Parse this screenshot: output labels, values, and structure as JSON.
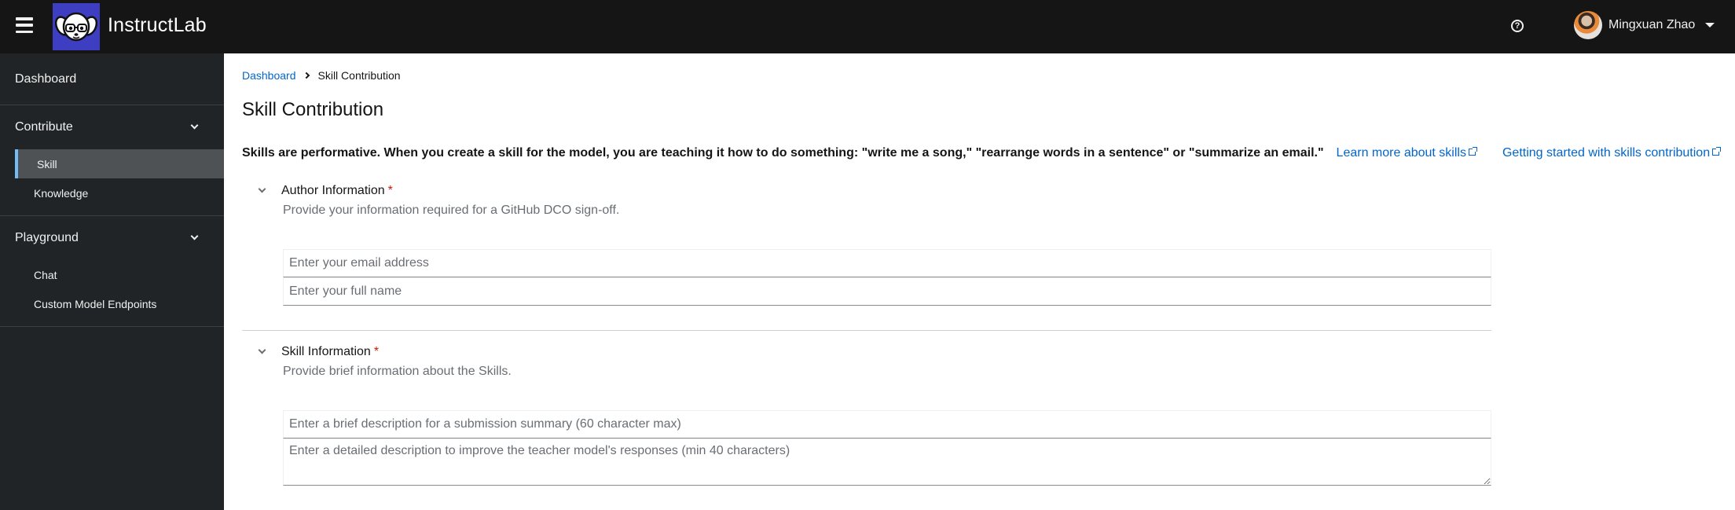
{
  "header": {
    "brand": "InstructLab",
    "user_name": "Mingxuan Zhao",
    "icons": {
      "menu": "hamburger-icon",
      "logo": "dog-with-glasses-logo",
      "help": "question-circle-icon",
      "user_menu": "caret-down-icon"
    },
    "logo_bg_color": "#3d3ec1"
  },
  "sidebar": {
    "items": [
      {
        "label": "Dashboard"
      },
      {
        "label": "Contribute",
        "expanded": true,
        "children": [
          {
            "label": "Skill",
            "active": true
          },
          {
            "label": "Knowledge"
          }
        ]
      },
      {
        "label": "Playground",
        "expanded": true,
        "children": [
          {
            "label": "Chat"
          },
          {
            "label": "Custom Model Endpoints"
          }
        ]
      }
    ],
    "active_color": "#73bcf7"
  },
  "main": {
    "breadcrumb": [
      "Dashboard",
      "Skill Contribution"
    ],
    "title": "Skill Contribution",
    "intro": "Skills are performative. When you create a skill for the model, you are teaching it how to do something: \"write me a song,\" \"rearrange words in a sentence\" or \"summarize an email.\"",
    "links": [
      {
        "label": "Learn more about skills",
        "icon": "external-link-icon"
      },
      {
        "label": "Getting started with skills contribution",
        "icon": "external-link-icon"
      }
    ],
    "sections": [
      {
        "title": "Author Information",
        "required_mark": "*",
        "description": "Provide your information required for a GitHub DCO sign-off.",
        "fields": [
          {
            "placeholder": "Enter your email address",
            "value": ""
          },
          {
            "placeholder": "Enter your full name",
            "value": ""
          }
        ]
      },
      {
        "title": "Skill Information",
        "required_mark": "*",
        "description": "Provide brief information about the Skills.",
        "fields": [
          {
            "placeholder": "Enter a brief description for a submission summary (60 character max)",
            "value": ""
          },
          {
            "placeholder": "Enter a detailed description to improve the teacher model's responses (min 40 characters)",
            "value": ""
          }
        ]
      }
    ]
  },
  "colors": {
    "link": "#0066cc",
    "required": "#c9190b",
    "masthead": "#151515",
    "sidebar": "#212427"
  }
}
